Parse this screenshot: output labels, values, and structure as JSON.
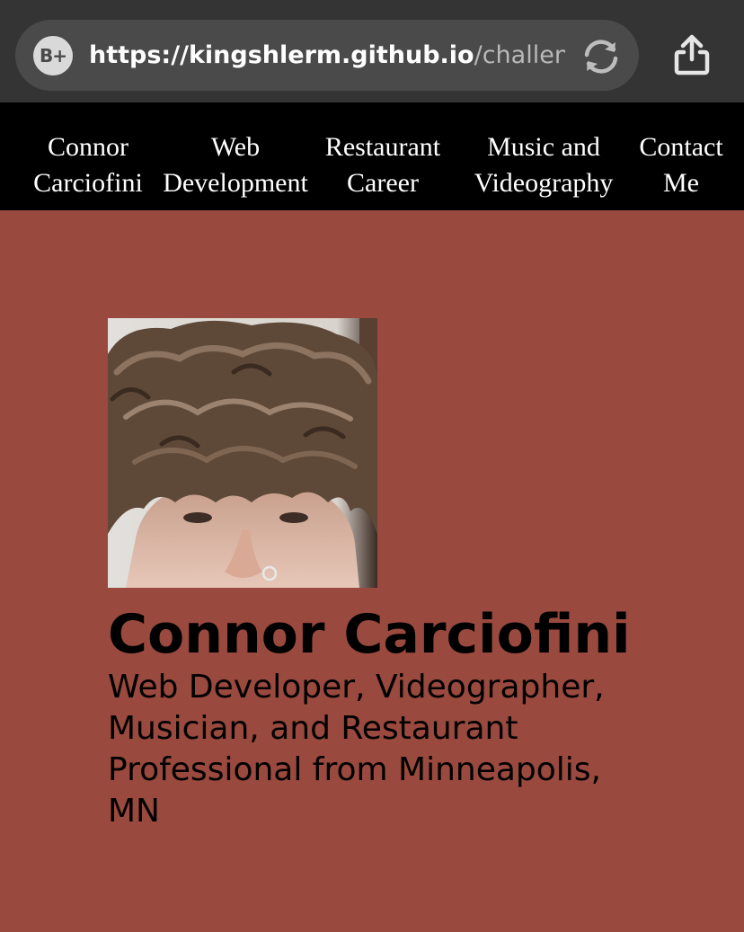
{
  "browser": {
    "badge_text": "B+",
    "url_host": "https://kingshlerm.github.io",
    "url_path": "/challen..."
  },
  "nav": {
    "items": [
      {
        "line1": "Connor",
        "line2": "Carciofini"
      },
      {
        "line1": "Web",
        "line2": "Development"
      },
      {
        "line1": "Restaurant",
        "line2": "Career"
      },
      {
        "line1": "Music and",
        "line2": "Videography"
      },
      {
        "line1": "Contact",
        "line2": "Me"
      }
    ]
  },
  "hero": {
    "name": "Connor Carciofini",
    "tagline": "Web Developer, Videographer, Musician, and Restaurant Professional from Minneapolis, MN"
  },
  "icons": {
    "badge": "bplus-icon",
    "reload": "reload-icon",
    "share": "share-icon"
  },
  "colors": {
    "page_background": "#99493d",
    "nav_background": "#000000",
    "browser_chrome": "#343434"
  }
}
